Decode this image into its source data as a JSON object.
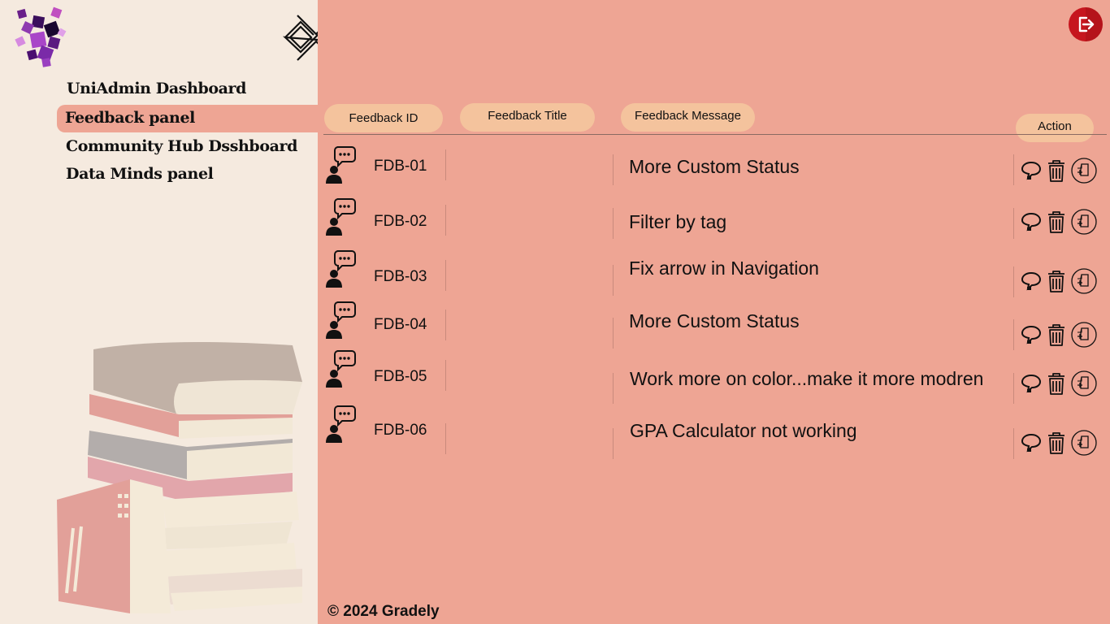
{
  "nav": {
    "items": [
      {
        "label": "UniAdmin Dashboard",
        "active": false
      },
      {
        "label": "Feedback panel",
        "active": true
      },
      {
        "label": "Community Hub Dsshboard",
        "active": false
      },
      {
        "label": "Data Minds panel",
        "active": false
      }
    ]
  },
  "table": {
    "headers": {
      "id": "Feedback ID",
      "title": "Feedback Title",
      "message": "Feedback Message",
      "action": "Action"
    },
    "rows": [
      {
        "id": "FDB-01",
        "title": "",
        "message": "More Custom Status"
      },
      {
        "id": "FDB-02",
        "title": "",
        "message": "Filter by tag"
      },
      {
        "id": "FDB-03",
        "title": "",
        "message": "Fix arrow in Navigation"
      },
      {
        "id": "FDB-04",
        "title": "",
        "message": "More Custom Status"
      },
      {
        "id": "FDB-05",
        "title": "",
        "message": "Work more on color...make it more modren"
      },
      {
        "id": "FDB-06",
        "title": "",
        "message": "GPA Calculator not working"
      }
    ],
    "row_actions": [
      "comment-icon",
      "trash-icon",
      "add-document-icon"
    ]
  },
  "footer": {
    "text": "© 2024 Gradely"
  },
  "colors": {
    "sidebar_bg": "#f5eadf",
    "main_bg": "#eea594",
    "pill_bg": "#f4c39d",
    "logout_bg": "#c6161e"
  }
}
